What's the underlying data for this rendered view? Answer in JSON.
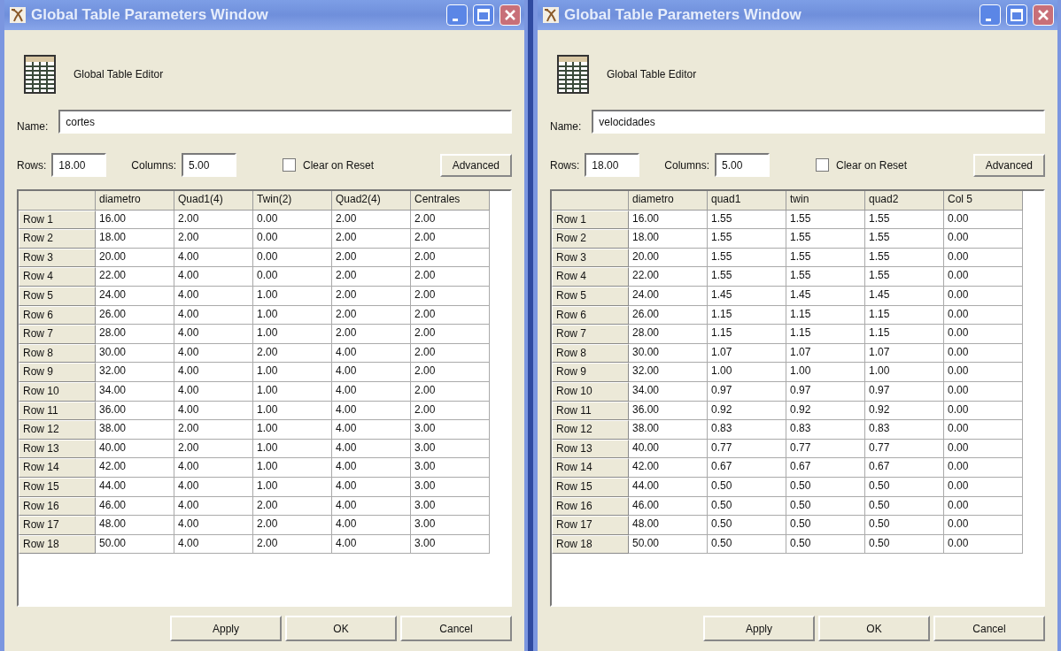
{
  "windows": [
    {
      "title": "Global Table Parameters Window",
      "editor_label": "Global Table Editor",
      "name_label": "Name:",
      "name_value": "cortes",
      "rows_label": "Rows:",
      "rows_value": "18.00",
      "columns_label": "Columns:",
      "columns_value": "5.00",
      "clear_on_reset": {
        "label": "Clear on Reset",
        "checked": false
      },
      "advanced_button": "Advanced",
      "table": {
        "columns": [
          "diametro",
          "Quad1(4)",
          "Twin(2)",
          "Quad2(4)",
          "Centrales"
        ],
        "rows": [
          {
            "label": "Row 1",
            "cells": [
              "16.00",
              "2.00",
              "0.00",
              "2.00",
              "2.00"
            ]
          },
          {
            "label": "Row 2",
            "cells": [
              "18.00",
              "2.00",
              "0.00",
              "2.00",
              "2.00"
            ]
          },
          {
            "label": "Row 3",
            "cells": [
              "20.00",
              "4.00",
              "0.00",
              "2.00",
              "2.00"
            ]
          },
          {
            "label": "Row 4",
            "cells": [
              "22.00",
              "4.00",
              "0.00",
              "2.00",
              "2.00"
            ]
          },
          {
            "label": "Row 5",
            "cells": [
              "24.00",
              "4.00",
              "1.00",
              "2.00",
              "2.00"
            ]
          },
          {
            "label": "Row 6",
            "cells": [
              "26.00",
              "4.00",
              "1.00",
              "2.00",
              "2.00"
            ]
          },
          {
            "label": "Row 7",
            "cells": [
              "28.00",
              "4.00",
              "1.00",
              "2.00",
              "2.00"
            ]
          },
          {
            "label": "Row 8",
            "cells": [
              "30.00",
              "4.00",
              "2.00",
              "4.00",
              "2.00"
            ]
          },
          {
            "label": "Row 9",
            "cells": [
              "32.00",
              "4.00",
              "1.00",
              "4.00",
              "2.00"
            ]
          },
          {
            "label": "Row 10",
            "cells": [
              "34.00",
              "4.00",
              "1.00",
              "4.00",
              "2.00"
            ]
          },
          {
            "label": "Row 11",
            "cells": [
              "36.00",
              "4.00",
              "1.00",
              "4.00",
              "2.00"
            ]
          },
          {
            "label": "Row 12",
            "cells": [
              "38.00",
              "2.00",
              "1.00",
              "4.00",
              "3.00"
            ]
          },
          {
            "label": "Row 13",
            "cells": [
              "40.00",
              "2.00",
              "1.00",
              "4.00",
              "3.00"
            ]
          },
          {
            "label": "Row 14",
            "cells": [
              "42.00",
              "4.00",
              "1.00",
              "4.00",
              "3.00"
            ]
          },
          {
            "label": "Row 15",
            "cells": [
              "44.00",
              "4.00",
              "1.00",
              "4.00",
              "3.00"
            ]
          },
          {
            "label": "Row 16",
            "cells": [
              "46.00",
              "4.00",
              "2.00",
              "4.00",
              "3.00"
            ]
          },
          {
            "label": "Row 17",
            "cells": [
              "48.00",
              "4.00",
              "2.00",
              "4.00",
              "3.00"
            ]
          },
          {
            "label": "Row 18",
            "cells": [
              "50.00",
              "4.00",
              "2.00",
              "4.00",
              "3.00"
            ]
          }
        ]
      },
      "buttons": [
        "Apply",
        "OK",
        "Cancel"
      ]
    },
    {
      "title": "Global Table Parameters Window",
      "editor_label": "Global Table Editor",
      "name_label": "Name:",
      "name_value": "velocidades",
      "rows_label": "Rows:",
      "rows_value": "18.00",
      "columns_label": "Columns:",
      "columns_value": "5.00",
      "clear_on_reset": {
        "label": "Clear on Reset",
        "checked": false
      },
      "advanced_button": "Advanced",
      "table": {
        "columns": [
          "diametro",
          "quad1",
          "twin",
          "quad2",
          "Col 5"
        ],
        "rows": [
          {
            "label": "Row 1",
            "cells": [
              "16.00",
              "1.55",
              "1.55",
              "1.55",
              "0.00"
            ]
          },
          {
            "label": "Row 2",
            "cells": [
              "18.00",
              "1.55",
              "1.55",
              "1.55",
              "0.00"
            ]
          },
          {
            "label": "Row 3",
            "cells": [
              "20.00",
              "1.55",
              "1.55",
              "1.55",
              "0.00"
            ]
          },
          {
            "label": "Row 4",
            "cells": [
              "22.00",
              "1.55",
              "1.55",
              "1.55",
              "0.00"
            ]
          },
          {
            "label": "Row 5",
            "cells": [
              "24.00",
              "1.45",
              "1.45",
              "1.45",
              "0.00"
            ]
          },
          {
            "label": "Row 6",
            "cells": [
              "26.00",
              "1.15",
              "1.15",
              "1.15",
              "0.00"
            ]
          },
          {
            "label": "Row 7",
            "cells": [
              "28.00",
              "1.15",
              "1.15",
              "1.15",
              "0.00"
            ]
          },
          {
            "label": "Row 8",
            "cells": [
              "30.00",
              "1.07",
              "1.07",
              "1.07",
              "0.00"
            ]
          },
          {
            "label": "Row 9",
            "cells": [
              "32.00",
              "1.00",
              "1.00",
              "1.00",
              "0.00"
            ]
          },
          {
            "label": "Row 10",
            "cells": [
              "34.00",
              "0.97",
              "0.97",
              "0.97",
              "0.00"
            ]
          },
          {
            "label": "Row 11",
            "cells": [
              "36.00",
              "0.92",
              "0.92",
              "0.92",
              "0.00"
            ]
          },
          {
            "label": "Row 12",
            "cells": [
              "38.00",
              "0.83",
              "0.83",
              "0.83",
              "0.00"
            ]
          },
          {
            "label": "Row 13",
            "cells": [
              "40.00",
              "0.77",
              "0.77",
              "0.77",
              "0.00"
            ]
          },
          {
            "label": "Row 14",
            "cells": [
              "42.00",
              "0.67",
              "0.67",
              "0.67",
              "0.00"
            ]
          },
          {
            "label": "Row 15",
            "cells": [
              "44.00",
              "0.50",
              "0.50",
              "0.50",
              "0.00"
            ]
          },
          {
            "label": "Row 16",
            "cells": [
              "46.00",
              "0.50",
              "0.50",
              "0.50",
              "0.00"
            ]
          },
          {
            "label": "Row 17",
            "cells": [
              "48.00",
              "0.50",
              "0.50",
              "0.50",
              "0.00"
            ]
          },
          {
            "label": "Row 18",
            "cells": [
              "50.00",
              "0.50",
              "0.50",
              "0.50",
              "0.00"
            ]
          }
        ]
      },
      "buttons": [
        "Apply",
        "OK",
        "Cancel"
      ]
    }
  ]
}
